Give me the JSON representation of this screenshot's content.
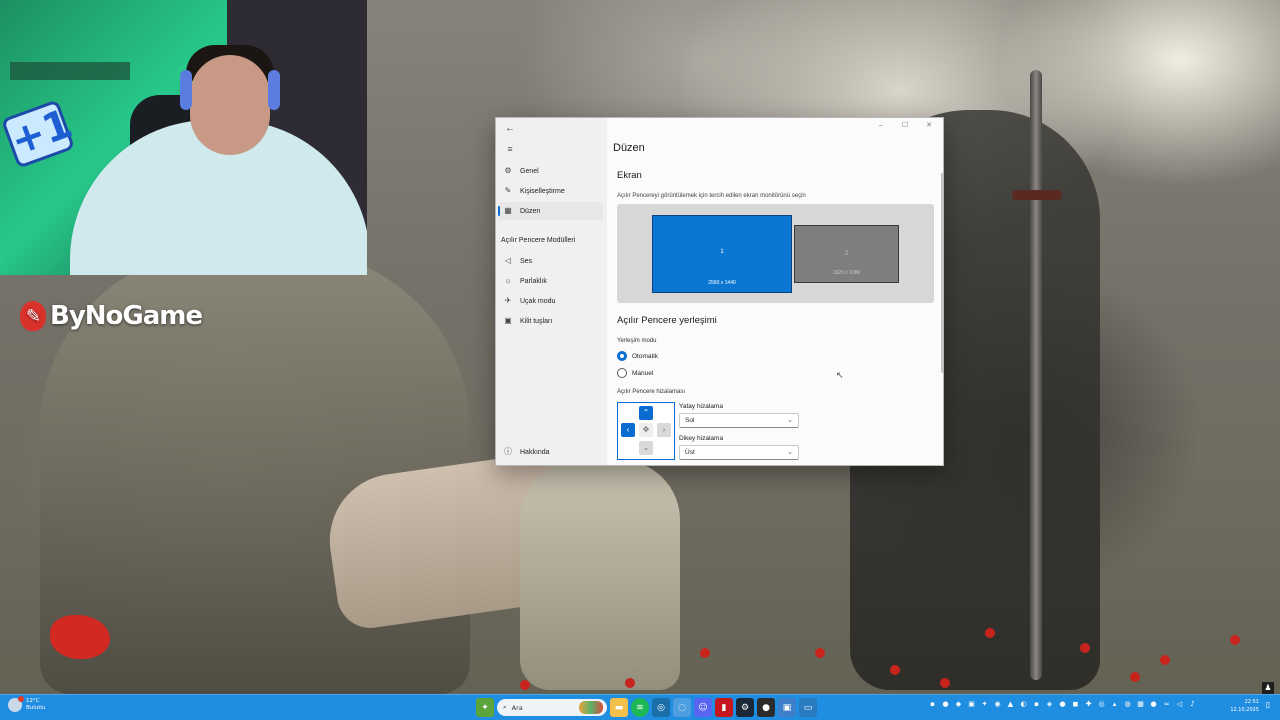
{
  "brand": {
    "logo_text": "ByNoGame"
  },
  "webcam": {
    "badge": "+1"
  },
  "window": {
    "controls": {
      "minimize": "–",
      "maximize": "☐",
      "close": "✕"
    },
    "nav": {
      "back_icon": "←",
      "menu_icon": "≡",
      "items": [
        {
          "label": "Genel",
          "icon": "gear-icon"
        },
        {
          "label": "Kişiselleştirme",
          "icon": "brush-icon"
        },
        {
          "label": "Düzen",
          "icon": "layout-icon",
          "active": true
        }
      ],
      "section_title": "Açılır Pencere Modülleri",
      "module_items": [
        {
          "label": "Ses",
          "icon": "speaker-icon"
        },
        {
          "label": "Parlaklık",
          "icon": "sun-icon"
        },
        {
          "label": "Uçak modu",
          "icon": "airplane-icon"
        },
        {
          "label": "Kilit tuşları",
          "icon": "lock-icon"
        }
      ],
      "about": {
        "label": "Hakkında",
        "icon": "info-icon"
      }
    },
    "page_title": "Düzen",
    "display_section": {
      "title": "Ekran",
      "description": "Açılır Pencereyi görüntülemek için tercih edilen ekran monitörünü seçin",
      "monitors": [
        {
          "number": "1",
          "resolution": "2560 x 1440",
          "selected": true
        },
        {
          "number": "2",
          "resolution": "1920 x 1080",
          "selected": false
        }
      ]
    },
    "placement_section": {
      "title": "Açılır Pencere yerleşimi",
      "mode_label": "Yerleşim modu",
      "options": [
        {
          "label": "Otomatik",
          "selected": true
        },
        {
          "label": "Manuel",
          "selected": false
        }
      ],
      "alignment_label": "Açılır Pencere hizalaması",
      "horizontal": {
        "label": "Yatay hizalama",
        "value": "Sol"
      },
      "vertical": {
        "label": "Dikey hizalama",
        "value": "Üst"
      }
    }
  },
  "taskbar": {
    "weather": {
      "temp": "12°C",
      "condition": "Bulutlu"
    },
    "search_placeholder": "Ara",
    "clock": {
      "time": "22:51",
      "date": "12.10.2025"
    },
    "colors": {
      "bar": "#1f8de0",
      "accent": "#0a6cd1"
    }
  }
}
